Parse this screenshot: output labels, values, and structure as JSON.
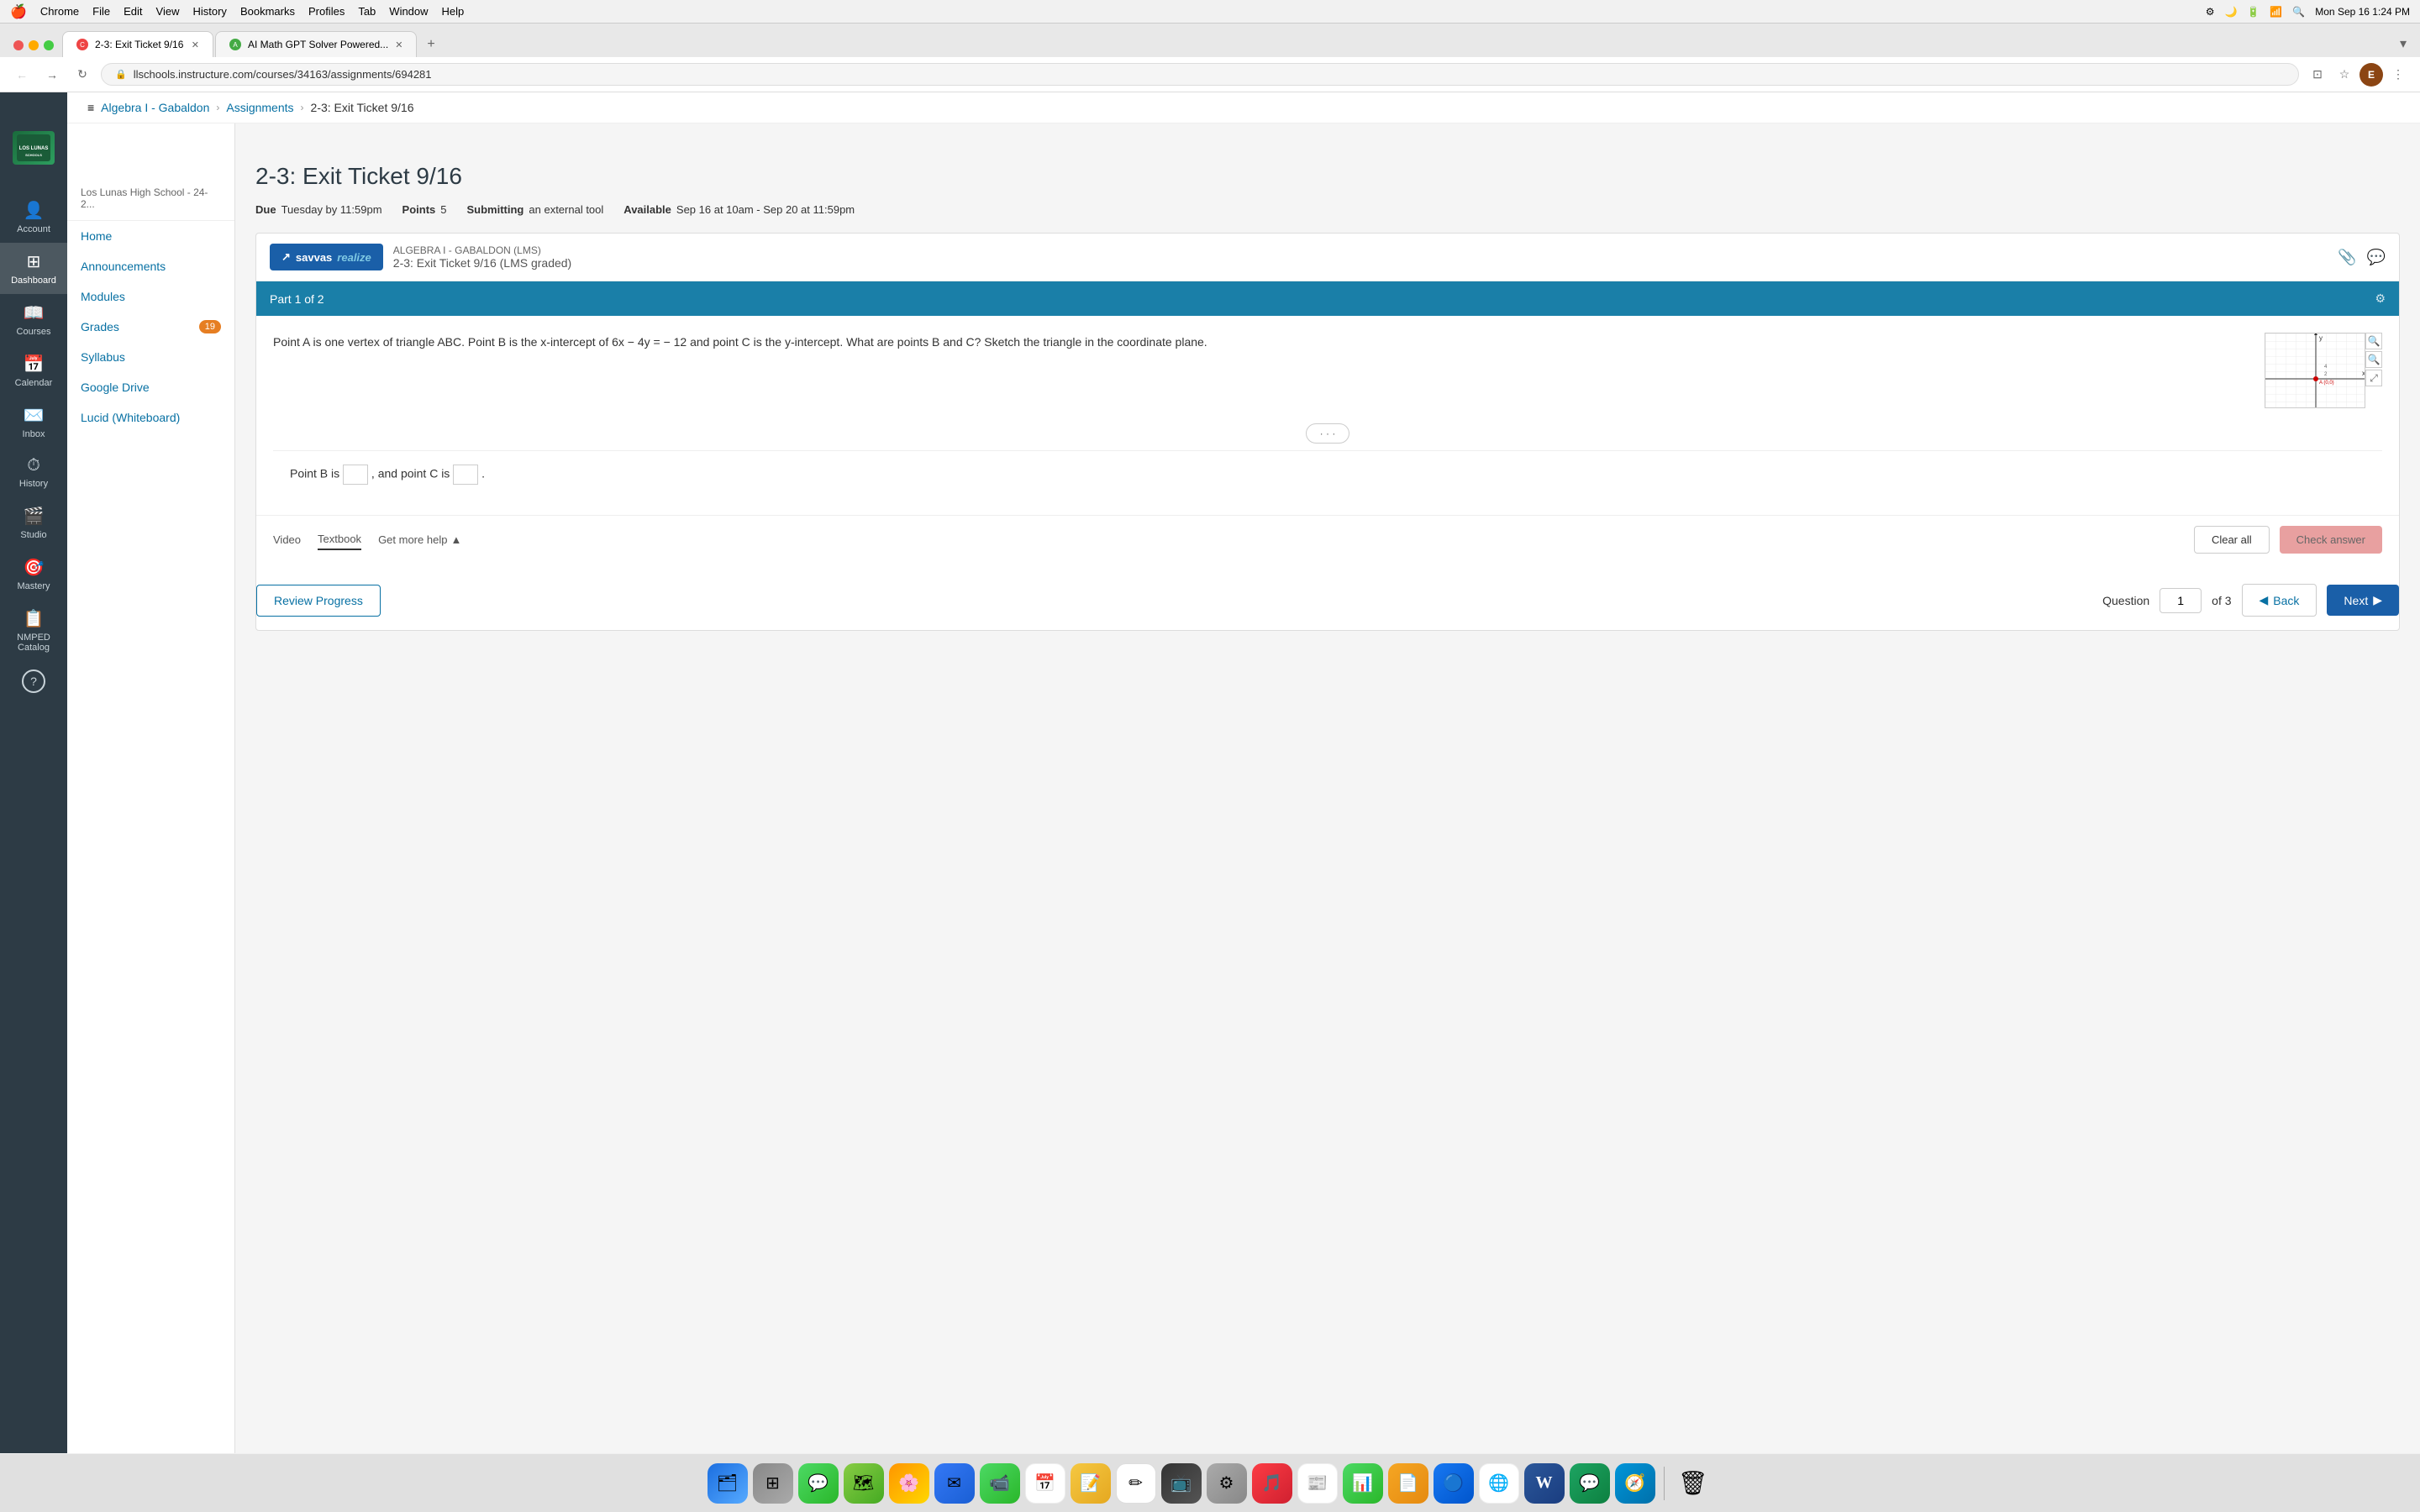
{
  "menubar": {
    "apple": "🍎",
    "items": [
      "Chrome",
      "File",
      "Edit",
      "View",
      "History",
      "Bookmarks",
      "Profiles",
      "Tab",
      "Window",
      "Help"
    ],
    "time": "Mon Sep 16  1:24 PM"
  },
  "tabs": [
    {
      "id": "tab1",
      "label": "2-3: Exit Ticket 9/16",
      "active": true,
      "color": "red"
    },
    {
      "id": "tab2",
      "label": "AI Math GPT Solver Powered...",
      "active": false,
      "color": "green"
    }
  ],
  "address_bar": {
    "url": "llschools.instructure.com/courses/34163/assignments/694281",
    "lock_icon": "🔒"
  },
  "breadcrumb": {
    "menu_icon": "≡",
    "course": "Algebra I - Gabaldon",
    "section": "Assignments",
    "current": "2-3: Exit Ticket 9/16"
  },
  "canvas_sidebar": {
    "logo_text": "LOS LUNAS SCHOOLS",
    "items": [
      {
        "id": "account",
        "icon": "👤",
        "label": "Account"
      },
      {
        "id": "dashboard",
        "icon": "⊞",
        "label": "Dashboard"
      },
      {
        "id": "courses",
        "icon": "📖",
        "label": "Courses"
      },
      {
        "id": "calendar",
        "icon": "📅",
        "label": "Calendar"
      },
      {
        "id": "inbox",
        "icon": "✉️",
        "label": "Inbox"
      },
      {
        "id": "history",
        "icon": "⏱",
        "label": "History"
      },
      {
        "id": "studio",
        "icon": "🎬",
        "label": "Studio"
      },
      {
        "id": "mastery",
        "icon": "🎯",
        "label": "Mastery"
      },
      {
        "id": "nmped",
        "icon": "📋",
        "label": "NMPED Catalog"
      },
      {
        "id": "help",
        "icon": "?",
        "label": ""
      }
    ]
  },
  "course_sidebar": {
    "header": "Los Lunas High School - 24-2...",
    "items": [
      {
        "id": "home",
        "label": "Home",
        "badge": null
      },
      {
        "id": "announcements",
        "label": "Announcements",
        "badge": null
      },
      {
        "id": "modules",
        "label": "Modules",
        "badge": null
      },
      {
        "id": "grades",
        "label": "Grades",
        "badge": "19"
      },
      {
        "id": "syllabus",
        "label": "Syllabus",
        "badge": null
      },
      {
        "id": "google_drive",
        "label": "Google Drive",
        "badge": null
      },
      {
        "id": "lucid",
        "label": "Lucid (Whiteboard)",
        "badge": null
      }
    ]
  },
  "assignment": {
    "title": "2-3: Exit Ticket 9/16",
    "due_label": "Due",
    "due_value": "Tuesday by 11:59pm",
    "points_label": "Points",
    "points_value": "5",
    "submitting_label": "Submitting",
    "submitting_value": "an external tool",
    "available_label": "Available",
    "available_value": "Sep 16 at 10am - Sep 20 at 11:59pm"
  },
  "savvas": {
    "provider_label": "ALGEBRA I - GABALDON (LMS)",
    "assignment_label": "2-3: Exit Ticket 9/16 (LMS graded)",
    "logo_icon": "↗",
    "logo_text": "savvas",
    "realize_text": "realize"
  },
  "part": {
    "label": "Part 1 of 2"
  },
  "question": {
    "text": "Point A is one vertex of triangle ABC. Point B is the x-intercept of 6x − 4y = − 12 and point C is the y-intercept. What are points B and C? Sketch the triangle in the coordinate plane.",
    "answer_prefix": "Point B is",
    "answer_separator": ", and point C is",
    "answer_suffix": "."
  },
  "toolbar": {
    "video_label": "Video",
    "textbook_label": "Textbook",
    "get_more_help_label": "Get more help",
    "clear_all_label": "Clear all",
    "check_answer_label": "Check answer"
  },
  "navigation": {
    "review_progress_label": "Review Progress",
    "question_label": "Question",
    "question_current": "1",
    "question_total": "of 3",
    "back_label": "Back",
    "next_label": "Next"
  },
  "dock": {
    "items": [
      {
        "id": "finder",
        "emoji": "🗂",
        "color": "#1b78d4"
      },
      {
        "id": "launchpad",
        "emoji": "⊞",
        "color": "#888"
      },
      {
        "id": "messages",
        "emoji": "💬",
        "color": "#4cd964"
      },
      {
        "id": "maps",
        "emoji": "🗺",
        "color": "#4cd964"
      },
      {
        "id": "photos",
        "emoji": "🌸",
        "color": "#ff9500"
      },
      {
        "id": "mail",
        "emoji": "✉",
        "color": "#3478f6"
      },
      {
        "id": "facetime",
        "emoji": "📹",
        "color": "#4cd964"
      },
      {
        "id": "reminders",
        "emoji": "📅",
        "color": "#e55353"
      },
      {
        "id": "stickies",
        "emoji": "📝",
        "color": "#f5c842"
      },
      {
        "id": "freeform",
        "emoji": "✏",
        "color": "#555"
      },
      {
        "id": "appletv",
        "emoji": "📺",
        "color": "#333"
      },
      {
        "id": "system_prefs",
        "emoji": "⚙",
        "color": "#888"
      },
      {
        "id": "music",
        "emoji": "🎵",
        "color": "#fc3c44"
      },
      {
        "id": "news",
        "emoji": "📰",
        "color": "#e55353"
      },
      {
        "id": "numbers",
        "emoji": "📊",
        "color": "#4cd964"
      },
      {
        "id": "pages",
        "emoji": "📄",
        "color": "#f5a623"
      },
      {
        "id": "appstore",
        "emoji": "🔵",
        "color": "#1778f2"
      },
      {
        "id": "chrome",
        "emoji": "🌐",
        "color": "#4285f4"
      },
      {
        "id": "word",
        "emoji": "W",
        "color": "#2b579a"
      },
      {
        "id": "googlechat",
        "emoji": "💬",
        "color": "#1da462"
      },
      {
        "id": "safari",
        "emoji": "🧭",
        "color": "#0095d9"
      },
      {
        "id": "trash",
        "emoji": "🗑",
        "color": "#888"
      }
    ]
  }
}
